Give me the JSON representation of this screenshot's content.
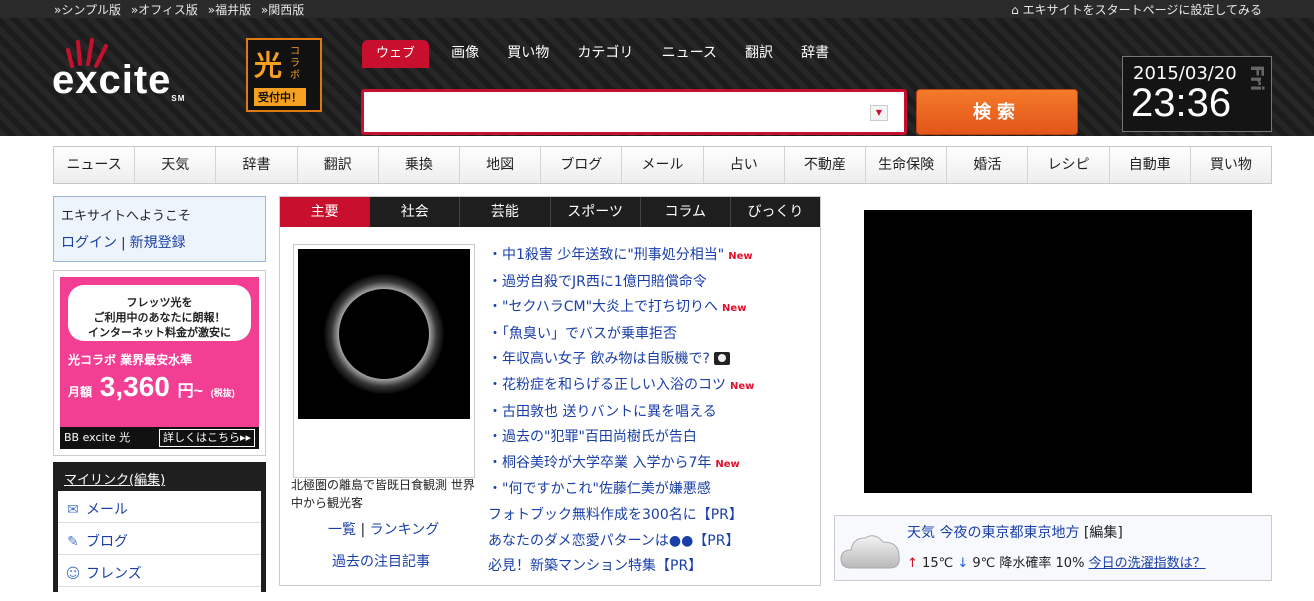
{
  "topbar": {
    "links": [
      "»シンプル版",
      "»オフィス版",
      "»福井版",
      "»関西版"
    ],
    "startpage": "エキサイトをスタートページに設定してみる"
  },
  "header": {
    "logo": "excite",
    "logo_sm": "SM",
    "kolabo": {
      "big": "光",
      "side": "コラボ",
      "bottom": "受付中！"
    },
    "search_tabs": [
      "ウェブ",
      "画像",
      "買い物",
      "カテゴリ",
      "ニュース",
      "翻訳",
      "辞書"
    ],
    "search_value": "",
    "search_button": "検索",
    "date": "2015/03/20",
    "time": "23:36",
    "day": "Fri"
  },
  "nav": [
    "ニュース",
    "天気",
    "辞書",
    "翻訳",
    "乗換",
    "地図",
    "ブログ",
    "メール",
    "占い",
    "不動産",
    "生命保険",
    "婚活",
    "レシピ",
    "自動車",
    "買い物"
  ],
  "welcome": {
    "title": "エキサイトへようこそ",
    "login": "ログイン",
    "sep": "|",
    "register": "新規登録"
  },
  "ad": {
    "line1": "フレッツ光を",
    "line2": "ご利用中のあなたに朗報！",
    "line3": "インターネット料金が激安に",
    "tag": "光コラボ 業界最安水準",
    "monthly": "月額",
    "price": "3,360",
    "unit": "円~",
    "tax": "(税抜)",
    "foot_logo": "BB excite 光",
    "foot_link": "詳しくはこちら▸▸"
  },
  "mylink": {
    "title": "マイリンク(編集)",
    "items": [
      {
        "icon": "mail-icon",
        "label": "メール"
      },
      {
        "icon": "blog-icon",
        "label": "ブログ"
      },
      {
        "icon": "friends-icon",
        "label": "フレンズ"
      }
    ]
  },
  "news": {
    "tabs": [
      "主要",
      "社会",
      "芸能",
      "スポーツ",
      "コラム",
      "びっくり"
    ],
    "photo_caption": "北極圏の離島で皆既日食観測 世界中から観光客",
    "photo_links": {
      "list": "一覧",
      "sep": "|",
      "ranking": "ランキング"
    },
    "past": "過去の注目記事",
    "new_label": "New",
    "items": [
      {
        "text": "・中1殺害 少年送致に\"刑事処分相当\"",
        "badge": "new"
      },
      {
        "text": "・過労自殺でJR西に1億円賠償命令",
        "badge": ""
      },
      {
        "text": "・\"セクハラCM\"大炎上で打ち切りへ",
        "badge": "new"
      },
      {
        "text": "・「魚臭い」でバスが乗車拒否",
        "badge": ""
      },
      {
        "text": "・年収高い女子 飲み物は自販機で?",
        "badge": "camera"
      },
      {
        "text": "・花粉症を和らげる正しい入浴のコツ",
        "badge": "new"
      },
      {
        "text": "・古田敦也 送りバントに異を唱える",
        "badge": ""
      },
      {
        "text": "・過去の\"犯罪\"百田尚樹氏が告白",
        "badge": ""
      },
      {
        "text": "・桐谷美玲が大学卒業 入学から7年",
        "badge": "new"
      },
      {
        "text": "・\"何ですかこれ\"佐藤仁美が嫌悪感",
        "badge": ""
      }
    ],
    "pr": [
      "フォトブック無料作成を300名に【PR】",
      "あなたのダメ恋愛パターンは●●【PR】",
      "必見！新築マンション特集【PR】"
    ]
  },
  "weather": {
    "label": "天気",
    "area": "今夜の東京都東京地方",
    "edit": "[編集]",
    "high": "15℃",
    "low": "9℃",
    "rain": "降水確率 10%",
    "laundry": "今日の洗濯指数は？"
  },
  "colors": {
    "accent": "#c8102e",
    "search_button": "#e2551a",
    "link": "#1a3fa8"
  }
}
